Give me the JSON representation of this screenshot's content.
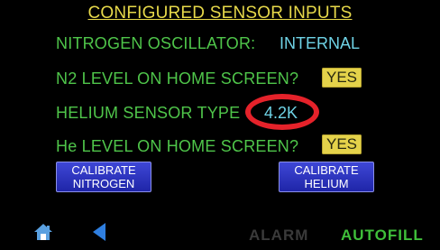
{
  "screen": {
    "title": "CONFIGURED SENSOR INPUTS"
  },
  "rows": {
    "nitrogen_oscillator": {
      "label": "NITROGEN OSCILLATOR:",
      "value": "INTERNAL"
    },
    "n2_home": {
      "label": "N2 LEVEL ON HOME SCREEN?",
      "button": "YES"
    },
    "helium_sensor": {
      "label": "HELIUM SENSOR TYPE",
      "value": "4.2K"
    },
    "he_home": {
      "label": "He LEVEL ON HOME SCREEN?",
      "button": "YES"
    }
  },
  "buttons": {
    "calibrate_nitrogen": [
      "CALIBRATE",
      "NITROGEN"
    ],
    "calibrate_helium": [
      "CALIBRATE",
      "HELIUM"
    ]
  },
  "footer": {
    "alarm": "ALARM",
    "autofill": "AUTOFILL"
  },
  "colors": {
    "background": "#000000",
    "title": "#e7d94a",
    "label": "#4fc54a",
    "value": "#6fd3e6",
    "button_yellow": "#e4d24a",
    "button_blue": "#2a32c0",
    "highlight_circle": "#e5222a",
    "alarm_inactive": "#3a3a3a",
    "autofill_active": "#3fbf3a",
    "home_icon": "#5aa0e0",
    "back_icon": "#2f7fe0"
  },
  "icons": {
    "home": "home-icon",
    "back": "back-arrow-icon"
  }
}
